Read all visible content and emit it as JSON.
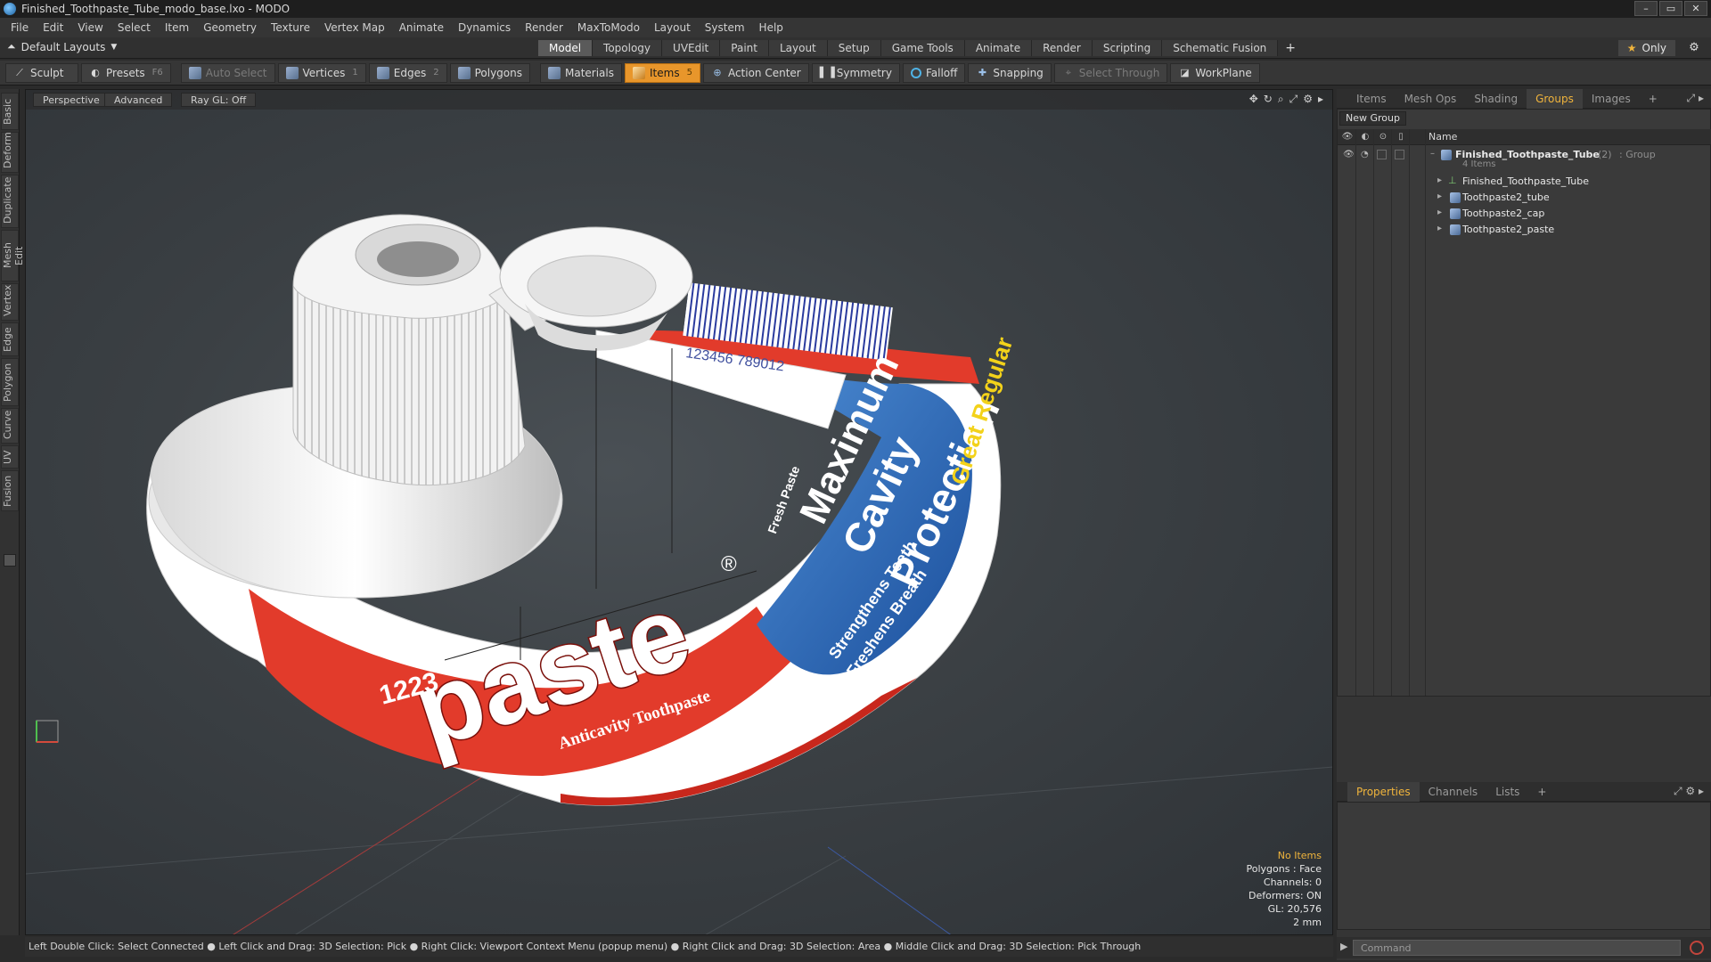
{
  "window": {
    "title": "Finished_Toothpaste_Tube_modo_base.lxo - MODO",
    "controls": [
      "–",
      "▭",
      "✕"
    ]
  },
  "menu": [
    "File",
    "Edit",
    "View",
    "Select",
    "Item",
    "Geometry",
    "Texture",
    "Vertex Map",
    "Animate",
    "Dynamics",
    "Render",
    "MaxToModo",
    "Layout",
    "System",
    "Help"
  ],
  "layout": {
    "preset_label": "Default Layouts",
    "tabs": [
      "Model",
      "Topology",
      "UVEdit",
      "Paint",
      "Layout",
      "Setup",
      "Game Tools",
      "Animate",
      "Render",
      "Scripting",
      "Schematic Fusion"
    ],
    "active_tab": "Model",
    "add_tab": "+",
    "only_label": "Only"
  },
  "toolbar": {
    "sculpt": "Sculpt",
    "presets": "Presets",
    "presets_key": "F6",
    "auto_select": "Auto Select",
    "vertices": "Vertices",
    "vertices_key": "1",
    "edges": "Edges",
    "edges_key": "2",
    "polygons": "Polygons",
    "materials": "Materials",
    "items": "Items",
    "items_key": "5",
    "action_center": "Action Center",
    "symmetry": "Symmetry",
    "falloff": "Falloff",
    "snapping": "Snapping",
    "select_through": "Select Through",
    "workplane": "WorkPlane"
  },
  "left_tabs": [
    "Basic",
    "Deform",
    "Duplicate",
    "Mesh Edit",
    "Vertex",
    "Edge",
    "Polygon",
    "Curve",
    "UV",
    "Fusion"
  ],
  "viewport": {
    "view_mode": "Perspective",
    "shading": "Advanced",
    "ray_gl": "Ray GL: Off",
    "info": {
      "selection": "No Items",
      "polygons": "Polygons : Face",
      "channels": "Channels: 0",
      "deformers": "Deformers: ON",
      "gl": "GL: 20,576",
      "scale": "2 mm"
    },
    "scene_text": {
      "brand": "paste",
      "registered": "®",
      "tagline": "Anticavity Toothpaste",
      "line1": "Maximum",
      "line2": "Cavity",
      "line3": "Protection",
      "great": "Great Regular",
      "benefit1": "Strengthens Teeth",
      "benefit2": "Freshens Breath",
      "fresh": "Fresh Paste",
      "barcode_digits": "123456 789012",
      "edge_digits": "1223"
    }
  },
  "statusbar": {
    "text": "Left Double Click: Select Connected ● Left Click and Drag: 3D Selection: Pick ● Right Click: Viewport Context Menu (popup menu) ● Right Click and Drag: 3D Selection: Area ● Middle Click and Drag: 3D Selection: Pick Through"
  },
  "right_panel": {
    "top_tabs": [
      "Items",
      "Mesh Ops",
      "Shading",
      "Groups",
      "Images"
    ],
    "active_top_tab": "Groups",
    "new_group": "New Group",
    "name_col": "Name",
    "group": {
      "name": "Finished_Toothpaste_Tube",
      "count": "(2)",
      "type": ": Group",
      "sub": "4 Items",
      "children": [
        "Finished_Toothpaste_Tube",
        "Toothpaste2_tube",
        "Toothpaste2_cap",
        "Toothpaste2_paste"
      ]
    },
    "bottom_tabs": [
      "Properties",
      "Channels",
      "Lists"
    ],
    "active_bottom_tab": "Properties",
    "command_placeholder": "Command"
  }
}
